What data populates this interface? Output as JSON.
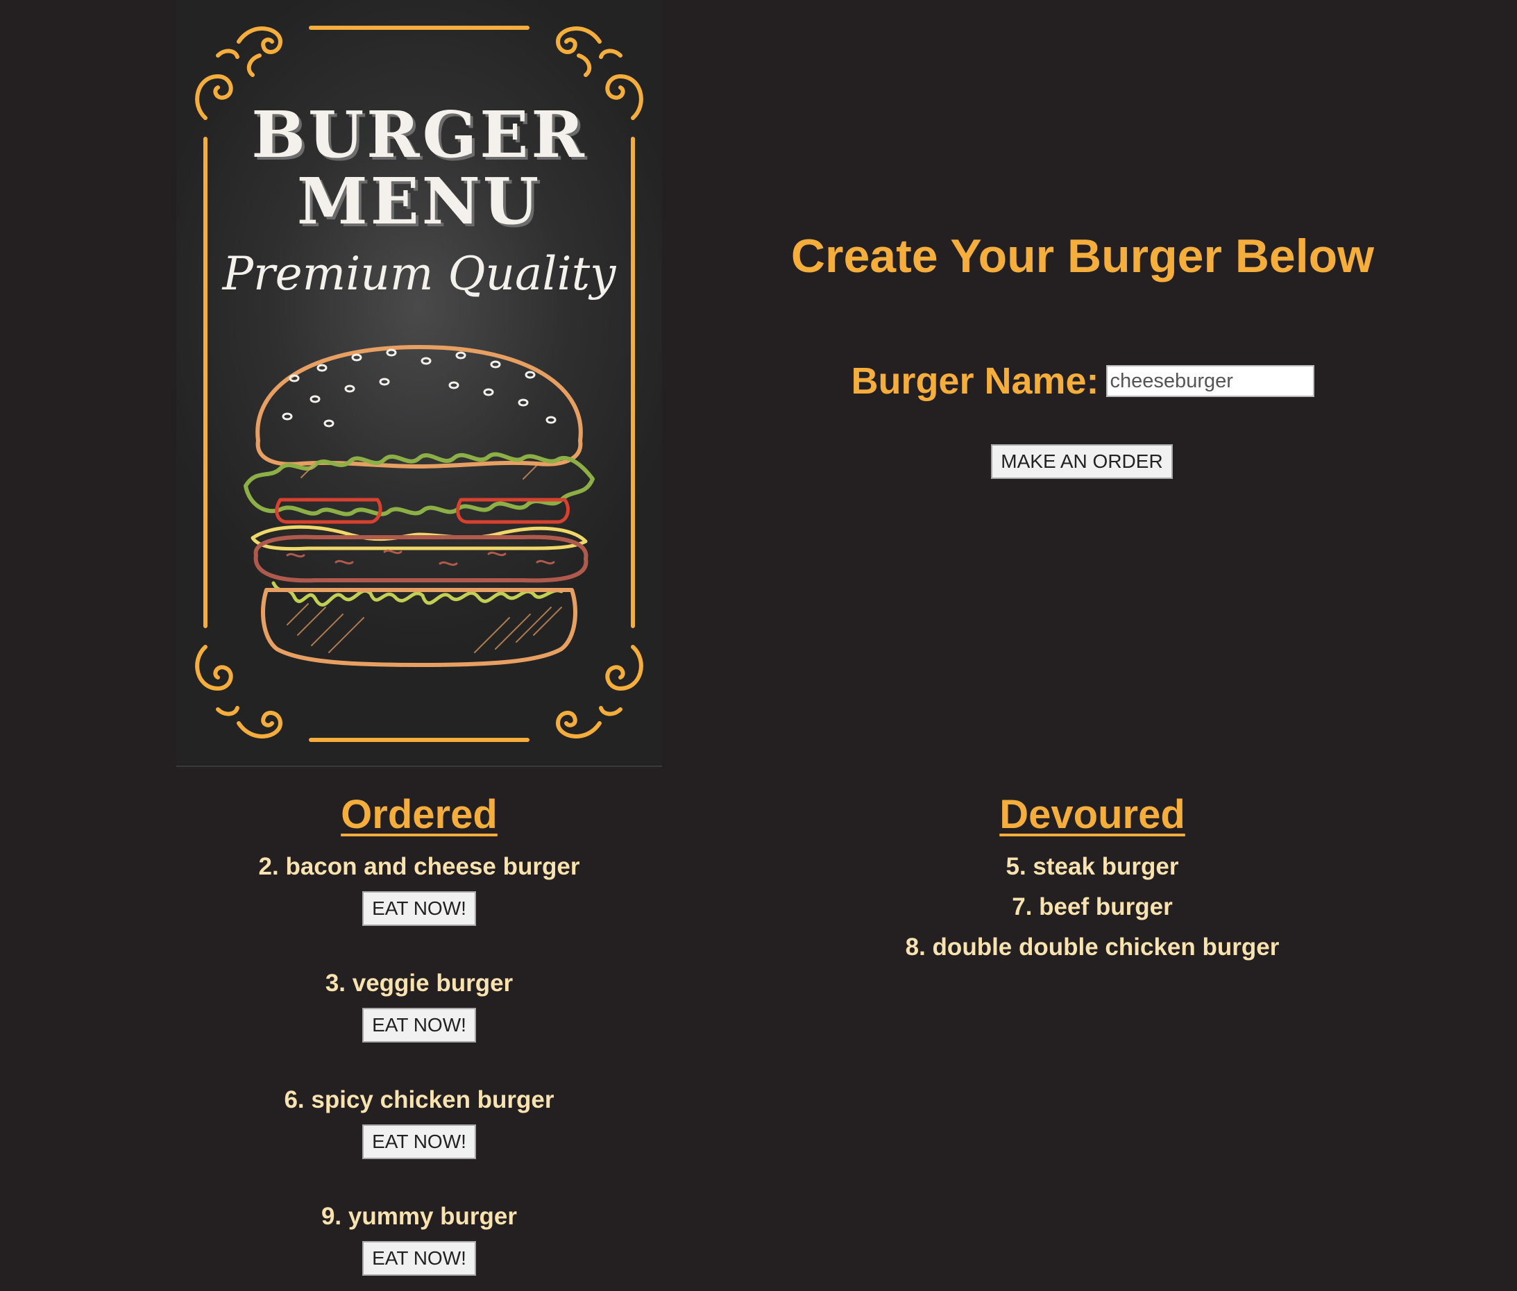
{
  "poster": {
    "title_line1": "BURGER",
    "title_line2": "MENU",
    "subtitle": "Premium Quality",
    "image": "burger-illustration"
  },
  "create": {
    "heading": "Create Your Burger Below",
    "name_label": "Burger Name:",
    "name_value": "cheeseburger",
    "order_button": "MAKE AN ORDER"
  },
  "ordered": {
    "heading": "Ordered",
    "items": [
      {
        "label": "2. bacon and cheese burger",
        "button": "EAT NOW!"
      },
      {
        "label": "3. veggie burger",
        "button": "EAT NOW!"
      },
      {
        "label": "6. spicy chicken burger",
        "button": "EAT NOW!"
      },
      {
        "label": "9. yummy burger",
        "button": "EAT NOW!"
      }
    ]
  },
  "devoured": {
    "heading": "Devoured",
    "items": [
      "5. steak burger",
      "7. beef burger",
      "8. double double chicken burger"
    ]
  },
  "colors": {
    "background": "#242021",
    "accent": "#f5ad3b",
    "item_text": "#f8e2b0"
  }
}
